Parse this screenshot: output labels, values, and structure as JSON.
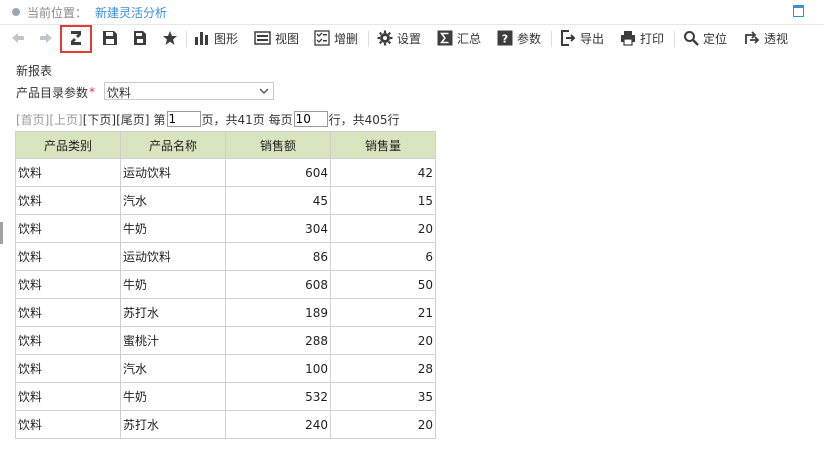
{
  "header": {
    "location_label": "当前位置：",
    "location_value": "新建灵活分析"
  },
  "toolbar": {
    "chart_label": "图形",
    "view_label": "视图",
    "add_delete_label": "增删",
    "settings_label": "设置",
    "summary_label": "汇总",
    "params_label": "参数",
    "export_label": "导出",
    "print_label": "打印",
    "locate_label": "定位",
    "pivot_label": "透视"
  },
  "report": {
    "title": "新报表"
  },
  "param": {
    "label": "产品目录参数",
    "required_mark": "*",
    "value": "饮料"
  },
  "pager": {
    "first": "[首页]",
    "prev": "[上页]",
    "next": "[下页]",
    "last": "[尾页]",
    "page_prefix": "第",
    "current_page": "1",
    "page_suffix": "页，共41页 每页",
    "page_size": "10",
    "total_text": "行，共405行"
  },
  "table": {
    "columns": [
      "产品类别",
      "产品名称",
      "销售额",
      "销售量"
    ],
    "rows": [
      [
        "饮料",
        "运动饮料",
        "604",
        "42"
      ],
      [
        "饮料",
        "汽水",
        "45",
        "15"
      ],
      [
        "饮料",
        "牛奶",
        "304",
        "20"
      ],
      [
        "饮料",
        "运动饮料",
        "86",
        "6"
      ],
      [
        "饮料",
        "牛奶",
        "608",
        "50"
      ],
      [
        "饮料",
        "苏打水",
        "189",
        "21"
      ],
      [
        "饮料",
        "蜜桃汁",
        "288",
        "20"
      ],
      [
        "饮料",
        "汽水",
        "100",
        "28"
      ],
      [
        "饮料",
        "牛奶",
        "532",
        "35"
      ],
      [
        "饮料",
        "苏打水",
        "240",
        "20"
      ]
    ]
  },
  "colors": {
    "accent": "#3b8ed3",
    "highlight_border": "#e53935",
    "table_header_bg": "#d7e4bd"
  }
}
